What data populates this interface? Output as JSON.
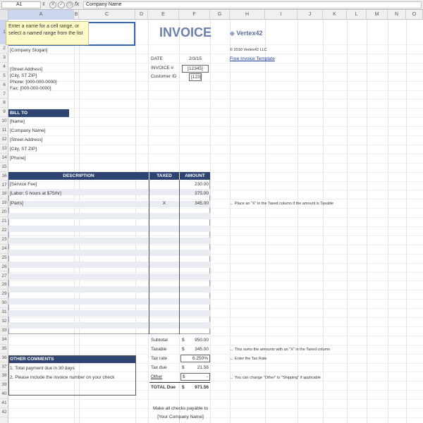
{
  "formula_bar": {
    "name_box": "A1",
    "fx": "fx",
    "value": "Company Name"
  },
  "columns": [
    "A",
    "B",
    "C",
    "D",
    "E",
    "F",
    "G",
    "H",
    "I",
    "J",
    "K",
    "L",
    "M",
    "N",
    "O",
    "P"
  ],
  "rows": [
    "1",
    "2",
    "3",
    "4",
    "5",
    "6",
    "7",
    "8",
    "9",
    "10",
    "11",
    "12",
    "13",
    "14",
    "15",
    "16",
    "17",
    "18",
    "19",
    "20",
    "21",
    "22",
    "23",
    "24",
    "25",
    "26",
    "27",
    "28",
    "29",
    "30",
    "31",
    "32",
    "33",
    "34",
    "35",
    "36",
    "37",
    "38",
    "39",
    "40",
    "41",
    "42"
  ],
  "tooltip": "Enter a name for a cell range, or select a named range from the list",
  "company": {
    "slogan": "[Company Slogan]",
    "street": "[Street Address]",
    "city": "[City, ST ZIP]",
    "phone": "Phone: [000-000-0000]",
    "fax": "Fax: [000-000-0000]"
  },
  "invoice": {
    "title": "INVOICE",
    "date_label": "DATE",
    "date_value": "2/3/15",
    "invoice_label": "INVOICE #",
    "invoice_value": "[12345]",
    "customer_label": "Customer ID",
    "customer_value": "[123]"
  },
  "vertex": {
    "logo": "Vertex42",
    "copyright": "© 2010 Vertex42 LLC",
    "link": "Free Invoice Template"
  },
  "bill_to": {
    "header": "BILL TO",
    "name": "[Name]",
    "company": "[Company Name]",
    "street": "[Street Address]",
    "city": "[City, ST ZIP]",
    "phone": "[Phone]"
  },
  "items": {
    "desc_header": "DESCRIPTION",
    "taxed_header": "TAXED",
    "amount_header": "AMOUNT",
    "rows": [
      {
        "desc": "[Service Fee]",
        "taxed": "",
        "amount": "230.00"
      },
      {
        "desc": "[Labor: 5 hours at $75/hr]",
        "taxed": "",
        "amount": "375.00"
      },
      {
        "desc": "[Parts]",
        "taxed": "X",
        "amount": "345.00"
      }
    ],
    "note": "← Place an \"X\" in the Taxed column if the amount is Taxable"
  },
  "totals": {
    "subtotal_label": "Subtotal",
    "subtotal_sym": "$",
    "subtotal_value": "950.00",
    "taxable_label": "Taxable",
    "taxable_sym": "$",
    "taxable_value": "345.00",
    "taxrate_label": "Tax rate",
    "taxrate_value": "6.250%",
    "taxdue_label": "Tax due",
    "taxdue_sym": "$",
    "taxdue_value": "21.56",
    "other_label": "Other",
    "other_sym": "$",
    "other_value": "-",
    "total_label": "TOTAL Due",
    "total_sym": "$",
    "total_value": "971.56",
    "note_taxable": "← This sums the amounts with an \"X\" in the Taxed column",
    "note_rate": "← Enter the Tax Rate",
    "note_other": "← You can change \"Other\" to \"Shipping\" if applicable"
  },
  "comments": {
    "header": "OTHER COMMENTS",
    "line1": "1. Total payment due in 30 days",
    "line2": "2. Please include the invoice number on your check"
  },
  "footer": {
    "line1": "Make all checks payable to",
    "line2": "[Your Company Name]"
  }
}
